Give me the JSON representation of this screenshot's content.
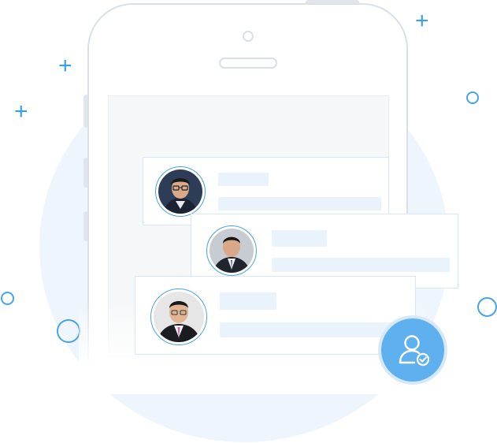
{
  "illustration": {
    "accent_color": "#4aa3e6",
    "badge_color": "#5fb0ee",
    "circle_color": "#eef5fd",
    "icons": [
      "plus-icon",
      "ring-icon",
      "user-check-icon"
    ]
  },
  "contacts": [
    {
      "avatar": "person-avatar-glasses"
    },
    {
      "avatar": "person-avatar-suit"
    },
    {
      "avatar": "person-avatar-tie"
    }
  ]
}
